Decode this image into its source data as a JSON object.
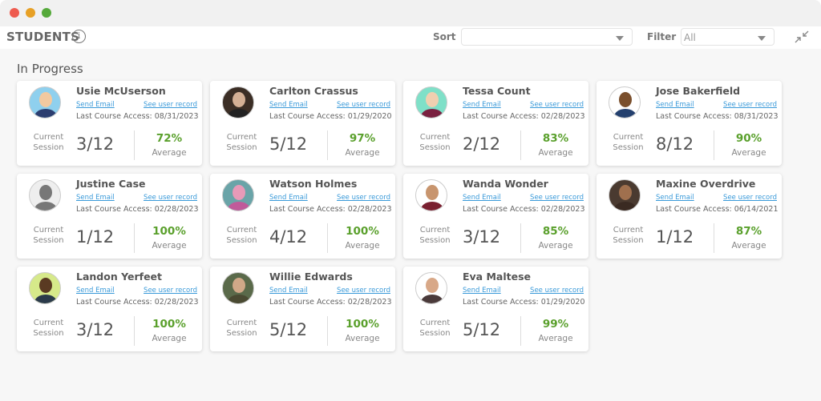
{
  "window": {
    "controls": [
      {
        "name": "close",
        "color": "#ee5b4f"
      },
      {
        "name": "minimize",
        "color": "#e7a025"
      },
      {
        "name": "maximize",
        "color": "#55a93a"
      }
    ]
  },
  "header": {
    "title": "STUDENTS",
    "info_icon": "i",
    "sort_label": "Sort",
    "sort_value": "",
    "filter_label": "Filter",
    "filter_value": "All",
    "collapse_icon": "collapse-arrows"
  },
  "section": {
    "title": "In Progress"
  },
  "labels": {
    "send_email": "Send Email",
    "see_record": "See user record",
    "current": "Current",
    "session": "Session",
    "average": "Average"
  },
  "students": [
    {
      "name": "Usie McUserson",
      "last_access": "Last Course Access: 08/31/2023",
      "session": "3/12",
      "average": "72%",
      "avatar_bg": "#8fd0ee",
      "skin": "#f2c9a0",
      "shirt": "#2c3e70"
    },
    {
      "name": "Carlton Crassus",
      "last_access": "Last Course Access: 01/29/2020",
      "session": "5/12",
      "average": "97%",
      "avatar_bg": "#3b2e25",
      "skin": "#d4b095",
      "shirt": "#222"
    },
    {
      "name": "Tessa Count",
      "last_access": "Last Course Access: 02/28/2023",
      "session": "2/12",
      "average": "83%",
      "avatar_bg": "#7fe0c8",
      "skin": "#f0cfb0",
      "shirt": "#7a2040"
    },
    {
      "name": "Jose Bakerfield",
      "last_access": "Last Course Access: 08/31/2023",
      "session": "8/12",
      "average": "90%",
      "avatar_bg": "#ffffff",
      "skin": "#7a4f2c",
      "shirt": "#24406e"
    },
    {
      "name": "Justine Case",
      "last_access": "Last Course Access: 02/28/2023",
      "session": "1/12",
      "average": "100%",
      "avatar_bg": "#eeeeee",
      "skin": "#777",
      "shirt": "#777"
    },
    {
      "name": "Watson Holmes",
      "last_access": "Last Course Access: 02/28/2023",
      "session": "4/12",
      "average": "100%",
      "avatar_bg": "#6aa4a8",
      "skin": "#e89ab8",
      "shirt": "#c05a9a"
    },
    {
      "name": "Wanda Wonder",
      "last_access": "Last Course Access: 02/28/2023",
      "session": "3/12",
      "average": "85%",
      "avatar_bg": "#ffffff",
      "skin": "#c8956e",
      "shirt": "#7a2030"
    },
    {
      "name": "Maxine Overdrive",
      "last_access": "Last Course Access: 06/14/2021",
      "session": "1/12",
      "average": "87%",
      "avatar_bg": "#4a3a30",
      "skin": "#a0704e",
      "shirt": "#3a2a22"
    },
    {
      "name": "Landon Yerfeet",
      "last_access": "Last Course Access: 02/28/2023",
      "session": "3/12",
      "average": "100%",
      "avatar_bg": "#d6e98a",
      "skin": "#5a3a22",
      "shirt": "#2a3a4a"
    },
    {
      "name": "Willie Edwards",
      "last_access": "Last Course Access: 02/28/2023",
      "session": "5/12",
      "average": "100%",
      "avatar_bg": "#5a6a4a",
      "skin": "#d0a888",
      "shirt": "#4a4a32"
    },
    {
      "name": "Eva Maltese",
      "last_access": "Last Course Access: 01/29/2020",
      "session": "5/12",
      "average": "99%",
      "avatar_bg": "#ffffff",
      "skin": "#d8a888",
      "shirt": "#4a3a3a"
    }
  ]
}
